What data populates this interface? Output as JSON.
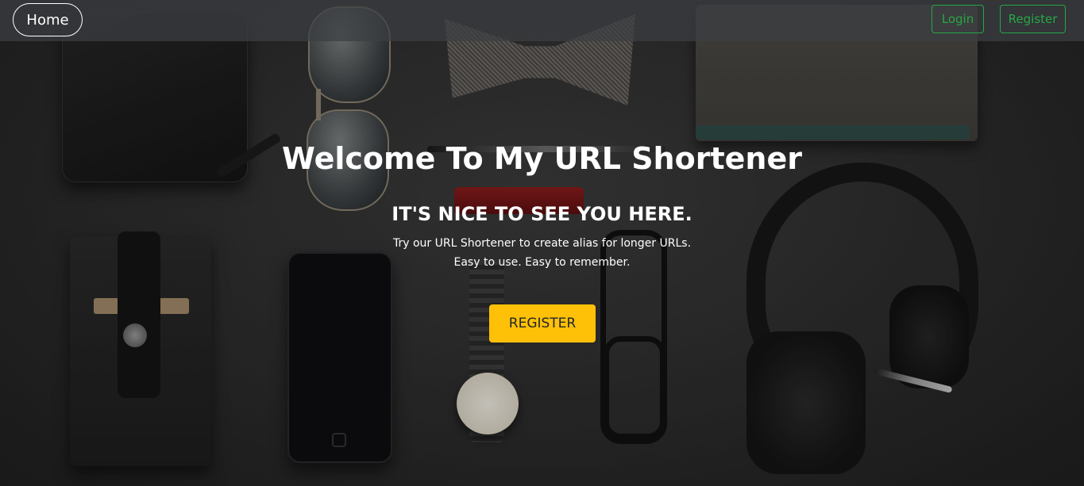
{
  "navbar": {
    "home_label": "Home",
    "login_label": "Login",
    "register_label": "Register"
  },
  "hero": {
    "title": "Welcome To My URL Shortener",
    "subtitle": "IT'S NICE TO SEE YOU HERE.",
    "line1": "Try our URL Shortener to create alias for longer URLs.",
    "line2": "Easy to use. Easy to remember.",
    "cta_label": "REGISTER"
  },
  "colors": {
    "nav_outline_success": "#28a745",
    "cta_warning": "#ffc107",
    "navbar_bg": "rgba(60,62,66,0.72)"
  }
}
